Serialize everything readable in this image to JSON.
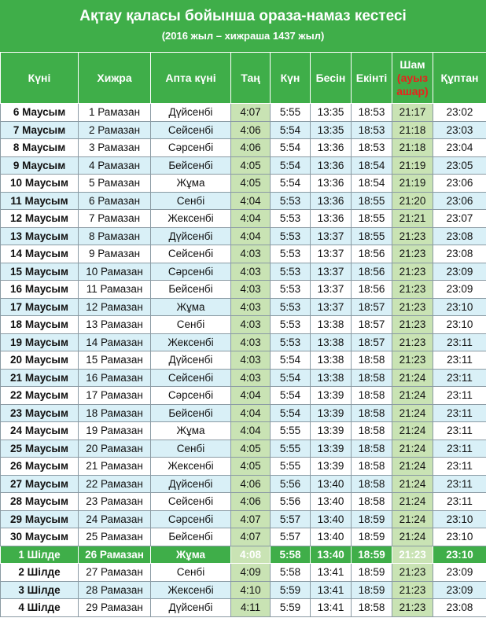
{
  "title": "Ақтау қаласы бойынша ораза-намаз кестесі",
  "subtitle": "(2016 жыл – хижраша 1437 жыл)",
  "headers": {
    "date": "Күні",
    "hijri": "Хижра",
    "weekday": "Апта күні",
    "fajr": "Таң",
    "sunrise": "Күн",
    "dhuhr": "Бесін",
    "asr": "Екінті",
    "maghrib": "Шам",
    "maghrib_note_1": "(ауыз",
    "maghrib_note_2": "ашар)",
    "isha": "Құптан"
  },
  "colors": {
    "green": "#3fae49",
    "light_blue": "#d9f0f7",
    "light_green": "#c9e3b4",
    "red_note": "#e8231c"
  },
  "highlighted_row_index": 25,
  "rows": [
    {
      "date": "6 Маусым",
      "hijri": "1 Рамазан",
      "weekday": "Дүйсенбі",
      "fajr": "4:07",
      "sunrise": "5:55",
      "dhuhr": "13:35",
      "asr": "18:53",
      "maghrib": "21:17",
      "isha": "23:02"
    },
    {
      "date": "7 Маусым",
      "hijri": "2 Рамазан",
      "weekday": "Сейсенбі",
      "fajr": "4:06",
      "sunrise": "5:54",
      "dhuhr": "13:35",
      "asr": "18:53",
      "maghrib": "21:18",
      "isha": "23:03"
    },
    {
      "date": "8 Маусым",
      "hijri": "3 Рамазан",
      "weekday": "Сәрсенбі",
      "fajr": "4:06",
      "sunrise": "5:54",
      "dhuhr": "13:36",
      "asr": "18:53",
      "maghrib": "21:18",
      "isha": "23:04"
    },
    {
      "date": "9 Маусым",
      "hijri": "4 Рамазан",
      "weekday": "Бейсенбі",
      "fajr": "4:05",
      "sunrise": "5:54",
      "dhuhr": "13:36",
      "asr": "18:54",
      "maghrib": "21:19",
      "isha": "23:05"
    },
    {
      "date": "10 Маусым",
      "hijri": "5 Рамазан",
      "weekday": "Жұма",
      "fajr": "4:05",
      "sunrise": "5:54",
      "dhuhr": "13:36",
      "asr": "18:54",
      "maghrib": "21:19",
      "isha": "23:06"
    },
    {
      "date": "11 Маусым",
      "hijri": "6 Рамазан",
      "weekday": "Сенбі",
      "fajr": "4:04",
      "sunrise": "5:53",
      "dhuhr": "13:36",
      "asr": "18:55",
      "maghrib": "21:20",
      "isha": "23:06"
    },
    {
      "date": "12 Маусым",
      "hijri": "7 Рамазан",
      "weekday": "Жексенбі",
      "fajr": "4:04",
      "sunrise": "5:53",
      "dhuhr": "13:36",
      "asr": "18:55",
      "maghrib": "21:21",
      "isha": "23:07"
    },
    {
      "date": "13 Маусым",
      "hijri": "8 Рамазан",
      "weekday": "Дүйсенбі",
      "fajr": "4:04",
      "sunrise": "5:53",
      "dhuhr": "13:37",
      "asr": "18:55",
      "maghrib": "21:23",
      "isha": "23:08"
    },
    {
      "date": "14 Маусым",
      "hijri": "9 Рамазан",
      "weekday": "Сейсенбі",
      "fajr": "4:03",
      "sunrise": "5:53",
      "dhuhr": "13:37",
      "asr": "18:56",
      "maghrib": "21:23",
      "isha": "23:08"
    },
    {
      "date": "15 Маусым",
      "hijri": "10 Рамазан",
      "weekday": "Сәрсенбі",
      "fajr": "4:03",
      "sunrise": "5:53",
      "dhuhr": "13:37",
      "asr": "18:56",
      "maghrib": "21:23",
      "isha": "23:09"
    },
    {
      "date": "16 Маусым",
      "hijri": "11 Рамазан",
      "weekday": "Бейсенбі",
      "fajr": "4:03",
      "sunrise": "5:53",
      "dhuhr": "13:37",
      "asr": "18:56",
      "maghrib": "21:23",
      "isha": "23:09"
    },
    {
      "date": "17 Маусым",
      "hijri": "12 Рамазан",
      "weekday": "Жұма",
      "fajr": "4:03",
      "sunrise": "5:53",
      "dhuhr": "13:37",
      "asr": "18:57",
      "maghrib": "21:23",
      "isha": "23:10"
    },
    {
      "date": "18 Маусым",
      "hijri": "13 Рамазан",
      "weekday": "Сенбі",
      "fajr": "4:03",
      "sunrise": "5:53",
      "dhuhr": "13:38",
      "asr": "18:57",
      "maghrib": "21:23",
      "isha": "23:10"
    },
    {
      "date": "19 Маусым",
      "hijri": "14 Рамазан",
      "weekday": "Жексенбі",
      "fajr": "4:03",
      "sunrise": "5:53",
      "dhuhr": "13:38",
      "asr": "18:57",
      "maghrib": "21:23",
      "isha": "23:11"
    },
    {
      "date": "20 Маусым",
      "hijri": "15 Рамазан",
      "weekday": "Дүйсенбі",
      "fajr": "4:03",
      "sunrise": "5:54",
      "dhuhr": "13:38",
      "asr": "18:58",
      "maghrib": "21:23",
      "isha": "23:11"
    },
    {
      "date": "21 Маусым",
      "hijri": "16 Рамазан",
      "weekday": "Сейсенбі",
      "fajr": "4:03",
      "sunrise": "5:54",
      "dhuhr": "13:38",
      "asr": "18:58",
      "maghrib": "21:24",
      "isha": "23:11"
    },
    {
      "date": "22 Маусым",
      "hijri": "17 Рамазан",
      "weekday": "Сәрсенбі",
      "fajr": "4:04",
      "sunrise": "5:54",
      "dhuhr": "13:39",
      "asr": "18:58",
      "maghrib": "21:24",
      "isha": "23:11"
    },
    {
      "date": "23 Маусым",
      "hijri": "18 Рамазан",
      "weekday": "Бейсенбі",
      "fajr": "4:04",
      "sunrise": "5:54",
      "dhuhr": "13:39",
      "asr": "18:58",
      "maghrib": "21:24",
      "isha": "23:11"
    },
    {
      "date": "24 Маусым",
      "hijri": "19 Рамазан",
      "weekday": "Жұма",
      "fajr": "4:04",
      "sunrise": "5:55",
      "dhuhr": "13:39",
      "asr": "18:58",
      "maghrib": "21:24",
      "isha": "23:11"
    },
    {
      "date": "25 Маусым",
      "hijri": "20 Рамазан",
      "weekday": "Сенбі",
      "fajr": "4:05",
      "sunrise": "5:55",
      "dhuhr": "13:39",
      "asr": "18:58",
      "maghrib": "21:24",
      "isha": "23:11"
    },
    {
      "date": "26 Маусым",
      "hijri": "21 Рамазан",
      "weekday": "Жексенбі",
      "fajr": "4:05",
      "sunrise": "5:55",
      "dhuhr": "13:39",
      "asr": "18:58",
      "maghrib": "21:24",
      "isha": "23:11"
    },
    {
      "date": "27 Маусым",
      "hijri": "22 Рамазан",
      "weekday": "Дүйсенбі",
      "fajr": "4:06",
      "sunrise": "5:56",
      "dhuhr": "13:40",
      "asr": "18:58",
      "maghrib": "21:24",
      "isha": "23:11"
    },
    {
      "date": "28 Маусым",
      "hijri": "23 Рамазан",
      "weekday": "Сейсенбі",
      "fajr": "4:06",
      "sunrise": "5:56",
      "dhuhr": "13:40",
      "asr": "18:58",
      "maghrib": "21:24",
      "isha": "23:11"
    },
    {
      "date": "29 Маусым",
      "hijri": "24 Рамазан",
      "weekday": "Сәрсенбі",
      "fajr": "4:07",
      "sunrise": "5:57",
      "dhuhr": "13:40",
      "asr": "18:59",
      "maghrib": "21:24",
      "isha": "23:10"
    },
    {
      "date": "30 Маусым",
      "hijri": "25 Рамазан",
      "weekday": "Бейсенбі",
      "fajr": "4:07",
      "sunrise": "5:57",
      "dhuhr": "13:40",
      "asr": "18:59",
      "maghrib": "21:24",
      "isha": "23:10"
    },
    {
      "date": "1 Шілде",
      "hijri": "26 Рамазан",
      "weekday": "Жұма",
      "fajr": "4:08",
      "sunrise": "5:58",
      "dhuhr": "13:40",
      "asr": "18:59",
      "maghrib": "21:23",
      "isha": "23:10"
    },
    {
      "date": "2 Шілде",
      "hijri": "27 Рамазан",
      "weekday": "Сенбі",
      "fajr": "4:09",
      "sunrise": "5:58",
      "dhuhr": "13:41",
      "asr": "18:59",
      "maghrib": "21:23",
      "isha": "23:09"
    },
    {
      "date": "3 Шілде",
      "hijri": "28 Рамазан",
      "weekday": "Жексенбі",
      "fajr": "4:10",
      "sunrise": "5:59",
      "dhuhr": "13:41",
      "asr": "18:59",
      "maghrib": "21:23",
      "isha": "23:09"
    },
    {
      "date": "4 Шілде",
      "hijri": "29 Рамазан",
      "weekday": "Дүйсенбі",
      "fajr": "4:11",
      "sunrise": "5:59",
      "dhuhr": "13:41",
      "asr": "18:58",
      "maghrib": "21:23",
      "isha": "23:08"
    }
  ]
}
